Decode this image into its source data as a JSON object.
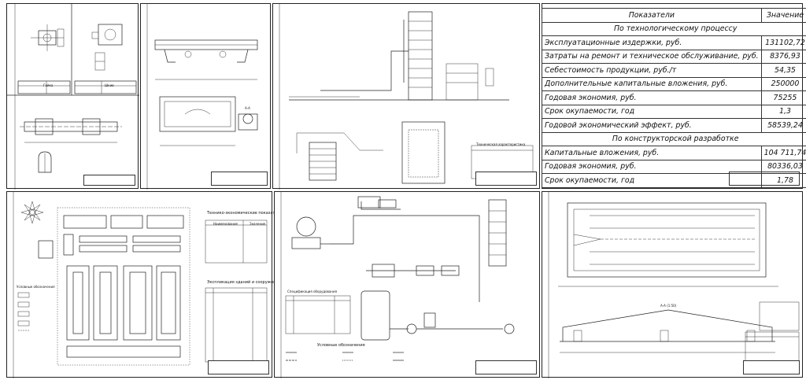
{
  "indicators_table": {
    "header": {
      "col_name": "Показатели",
      "col_value": "Значение"
    },
    "sections": [
      {
        "title": "По технологическому процессу",
        "rows": [
          {
            "name": "Эксплуатационные издержки, руб.",
            "value": "131102,72"
          },
          {
            "name": "Затраты на ремонт и техническое обслуживание, руб.",
            "value": "8376,93"
          },
          {
            "name": "Себестоимость продукции, руб./т",
            "value": "54,35"
          },
          {
            "name": "Дополнительные капитальные вложения, руб.",
            "value": "250000"
          },
          {
            "name": "Годовая экономия, руб.",
            "value": "75255"
          },
          {
            "name": "Срок окупаемости, год",
            "value": "1,3"
          },
          {
            "name": "Годовой экономический эффект, руб.",
            "value": "58539,24"
          }
        ]
      },
      {
        "title": "По конструкторской разработке",
        "rows": [
          {
            "name": "Капитальные вложения, руб.",
            "value": "104 711,74"
          },
          {
            "name": "Годовая экономия, руб.",
            "value": "80336,03"
          },
          {
            "name": "Срок окупаемости, год",
            "value": "1,78"
          }
        ]
      }
    ]
  },
  "labels": {
    "tech_econ_title": "Технико-экономические показатели",
    "explication_title": "Экспликация зданий и сооружений",
    "legend_title": "Условные обозначения",
    "spec_title": "Спецификация оборудования",
    "tech_char_title": "Техническая характеристика",
    "section_aa": "А-А",
    "section_aa2": "А-А (1:50)",
    "detail_title": "Гайка",
    "detail_title2": "Шкив",
    "col_naim": "Наименование",
    "col_zn": "Значение"
  }
}
